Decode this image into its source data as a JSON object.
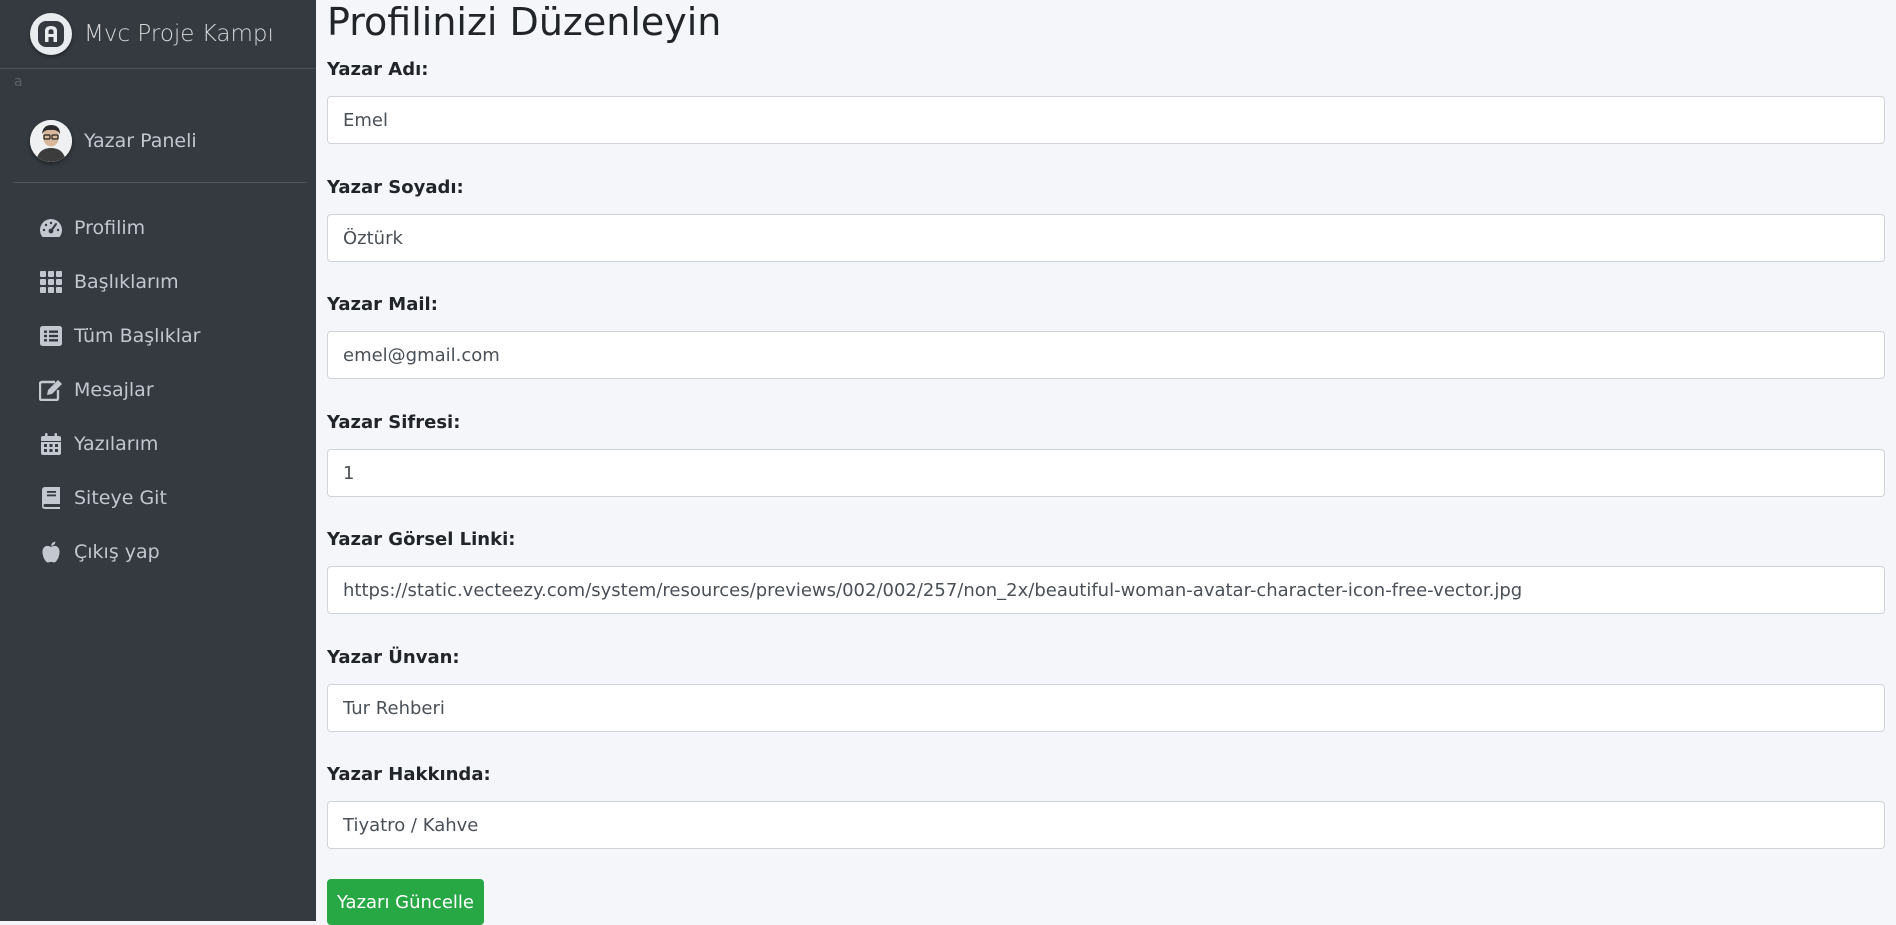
{
  "brand": {
    "title": "Mvc Proje Kampı",
    "logo_icon": "adminlte-logo-icon"
  },
  "stray_text": "a",
  "user_panel": {
    "name": "Yazar Paneli",
    "avatar_icon": "user-avatar-icon"
  },
  "nav": [
    {
      "label": "Profilim",
      "icon": "tachometer-icon"
    },
    {
      "label": "Başlıklarım",
      "icon": "grid-icon"
    },
    {
      "label": "Tüm Başlıklar",
      "icon": "list-icon"
    },
    {
      "label": "Mesajlar",
      "icon": "edit-icon"
    },
    {
      "label": "Yazılarım",
      "icon": "calendar-icon"
    },
    {
      "label": "Siteye Git",
      "icon": "book-icon"
    },
    {
      "label": "Çıkış yap",
      "icon": "apple-icon"
    }
  ],
  "page_title": "Profilinizi Düzenleyin",
  "form": {
    "first_name": {
      "label": "Yazar Adı:",
      "value": "Emel"
    },
    "last_name": {
      "label": "Yazar Soyadı:",
      "value": "Öztürk"
    },
    "mail": {
      "label": "Yazar Mail:",
      "value": "emel@gmail.com"
    },
    "password": {
      "label": "Yazar Sifresi:",
      "value": "1"
    },
    "image_link": {
      "label": "Yazar Görsel Linki:",
      "value": "https://static.vecteezy.com/system/resources/previews/002/002/257/non_2x/beautiful-woman-avatar-character-icon-free-vector.jpg"
    },
    "title": {
      "label": "Yazar Ünvan:",
      "value": "Tur Rehberi"
    },
    "about": {
      "label": "Yazar Hakkında:",
      "value": "Tiyatro / Kahve"
    },
    "submit_label": "Yazarı Güncelle"
  },
  "colors": {
    "sidebar_bg": "#343a40",
    "content_bg": "#f4f6f9",
    "success": "#28a745"
  }
}
